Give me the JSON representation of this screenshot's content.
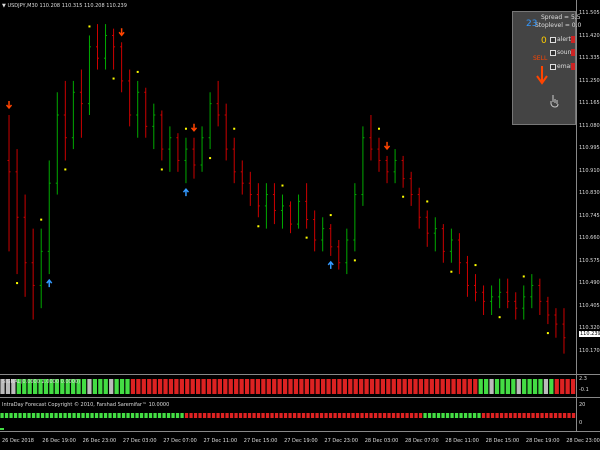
{
  "chart_header": {
    "symbol": "USDJPY,M30",
    "ohlc": "110.208 110.315 110.208 110.239"
  },
  "price_axis": {
    "labels": [
      "111.505",
      "111.420",
      "111.335",
      "111.250",
      "111.165",
      "111.080",
      "110.995",
      "110.910",
      "110.830",
      "110.745",
      "110.660",
      "110.575",
      "110.490",
      "110.405",
      "110.320",
      "110.170"
    ],
    "current_price": "110.239"
  },
  "panel": {
    "spread": "Spread = 5.5",
    "stoplevel": "Stoplevel = 0.0",
    "countdown": "23",
    "zero": "0",
    "signal": "SELL",
    "alert_label": "alert",
    "sound_label": "sound",
    "email_label": "email"
  },
  "indicator1": {
    "label": "SIGNAL(0.0000 2.0000 0.0000)",
    "axis": [
      "2.3",
      "-0.1"
    ]
  },
  "indicator2": {
    "label": "IntraDay Forecast Copyright © 2010, Farshad Saremifar™  10.0000",
    "axis": [
      "20",
      "0"
    ]
  },
  "time_axis": [
    "26 Dec 2018",
    "26 Dec 19:00",
    "26 Dec 23:00",
    "27 Dec 03:00",
    "27 Dec 07:00",
    "27 Dec 11:00",
    "27 Dec 15:00",
    "27 Dec 19:00",
    "27 Dec 23:00",
    "28 Dec 03:00",
    "28 Dec 07:00",
    "28 Dec 11:00",
    "28 Dec 15:00",
    "28 Dec 19:00",
    "28 Dec 23:00"
  ],
  "colors": {
    "bull": "#00aa00",
    "bear": "#cc0000",
    "dot": "#ffff00",
    "arrow_up": "#3399ff",
    "arrow_down": "#ff4400",
    "hist_gray": "#bbbbbb",
    "hist_green": "#44dd44",
    "hist_red": "#dd2222"
  },
  "chart_data": {
    "type": "candlestick",
    "points": [
      [
        111.0,
        111.2,
        110.6,
        110.95
      ],
      [
        110.95,
        111.05,
        110.5,
        110.75
      ],
      [
        110.75,
        110.85,
        110.4,
        110.55
      ],
      [
        110.55,
        110.7,
        110.3,
        110.45
      ],
      [
        110.45,
        110.7,
        110.35,
        110.6
      ],
      [
        110.6,
        111.0,
        110.5,
        110.9
      ],
      [
        110.9,
        111.3,
        110.85,
        111.2
      ],
      [
        111.2,
        111.35,
        111.0,
        111.1
      ],
      [
        111.1,
        111.35,
        111.05,
        111.3
      ],
      [
        111.3,
        111.4,
        111.1,
        111.25
      ],
      [
        111.25,
        111.55,
        111.2,
        111.5
      ],
      [
        111.5,
        111.6,
        111.4,
        111.45
      ],
      [
        111.45,
        111.6,
        111.4,
        111.55
      ],
      [
        111.55,
        111.58,
        111.4,
        111.5
      ],
      [
        111.5,
        111.52,
        111.3,
        111.35
      ],
      [
        111.35,
        111.4,
        111.15,
        111.2
      ],
      [
        111.2,
        111.35,
        111.1,
        111.3
      ],
      [
        111.3,
        111.32,
        111.1,
        111.15
      ],
      [
        111.15,
        111.25,
        111.05,
        111.2
      ],
      [
        111.2,
        111.22,
        111.0,
        111.05
      ],
      [
        111.05,
        111.15,
        110.95,
        111.1
      ],
      [
        111.1,
        111.12,
        110.95,
        111.0
      ],
      [
        111.0,
        111.1,
        110.9,
        111.05
      ],
      [
        111.05,
        111.1,
        110.92,
        110.98
      ],
      [
        110.98,
        111.15,
        110.95,
        111.1
      ],
      [
        111.1,
        111.3,
        111.05,
        111.25
      ],
      [
        111.25,
        111.35,
        111.15,
        111.2
      ],
      [
        111.2,
        111.25,
        111.0,
        111.05
      ],
      [
        111.05,
        111.1,
        110.9,
        110.95
      ],
      [
        110.95,
        111.0,
        110.85,
        110.9
      ],
      [
        110.9,
        110.95,
        110.8,
        110.85
      ],
      [
        110.85,
        110.9,
        110.75,
        110.8
      ],
      [
        110.8,
        110.9,
        110.7,
        110.85
      ],
      [
        110.85,
        110.9,
        110.72,
        110.78
      ],
      [
        110.78,
        110.85,
        110.7,
        110.8
      ],
      [
        110.8,
        110.82,
        110.68,
        110.72
      ],
      [
        110.72,
        110.85,
        110.7,
        110.82
      ],
      [
        110.82,
        110.9,
        110.7,
        110.74
      ],
      [
        110.74,
        110.78,
        110.6,
        110.65
      ],
      [
        110.65,
        110.75,
        110.6,
        110.7
      ],
      [
        110.7,
        110.72,
        110.58,
        110.62
      ],
      [
        110.62,
        110.65,
        110.52,
        110.55
      ],
      [
        110.55,
        110.7,
        110.5,
        110.65
      ],
      [
        110.65,
        110.9,
        110.6,
        110.85
      ],
      [
        110.85,
        111.15,
        110.8,
        111.1
      ],
      [
        111.1,
        111.2,
        111.0,
        111.05
      ],
      [
        111.05,
        111.1,
        110.95,
        111.0
      ],
      [
        111.0,
        111.02,
        110.9,
        110.95
      ],
      [
        110.95,
        111.05,
        110.9,
        111.0
      ],
      [
        111.0,
        111.02,
        110.88,
        110.92
      ],
      [
        110.92,
        110.95,
        110.8,
        110.85
      ],
      [
        110.85,
        110.88,
        110.7,
        110.75
      ],
      [
        110.75,
        110.78,
        110.62,
        110.68
      ],
      [
        110.68,
        110.75,
        110.6,
        110.7
      ],
      [
        110.7,
        110.72,
        110.55,
        110.6
      ],
      [
        110.6,
        110.7,
        110.55,
        110.65
      ],
      [
        110.65,
        110.68,
        110.5,
        110.55
      ],
      [
        110.55,
        110.58,
        110.4,
        110.45
      ],
      [
        110.45,
        110.5,
        110.38,
        110.42
      ],
      [
        110.42,
        110.45,
        110.32,
        110.38
      ],
      [
        110.38,
        110.45,
        110.32,
        110.4
      ],
      [
        110.4,
        110.48,
        110.35,
        110.42
      ],
      [
        110.42,
        110.48,
        110.35,
        110.38
      ],
      [
        110.38,
        110.42,
        110.3,
        110.35
      ],
      [
        110.35,
        110.45,
        110.3,
        110.4
      ],
      [
        110.4,
        110.5,
        110.35,
        110.45
      ],
      [
        110.45,
        110.48,
        110.32,
        110.38
      ],
      [
        110.38,
        110.4,
        110.28,
        110.32
      ],
      [
        110.32,
        110.35,
        110.22,
        110.28
      ],
      [
        110.28,
        110.35,
        110.15,
        110.22
      ]
    ],
    "ylim": [
      110.1,
      111.64
    ]
  }
}
